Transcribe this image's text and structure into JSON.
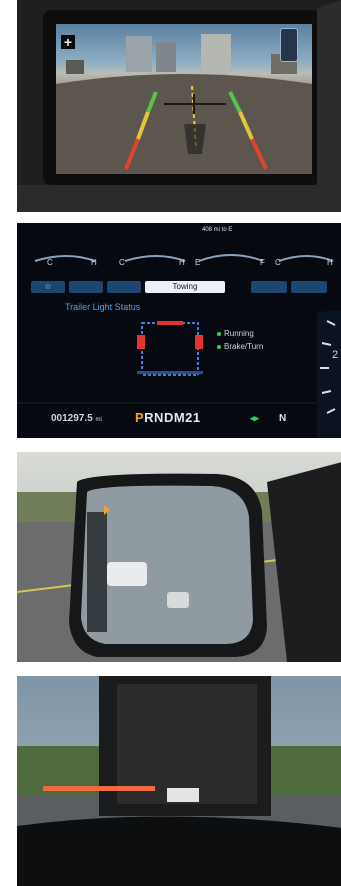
{
  "camera": {
    "plus_label": "+",
    "colors": {
      "near_line": "#e0432c",
      "mid_line": "#e2c63a",
      "far_line": "#58c24b",
      "centerline": "#f1c232"
    }
  },
  "cluster": {
    "top_readout": "408 mi to E",
    "fuel_empty": "E",
    "fuel_full": "F",
    "gauge_cold": "C",
    "gauge_hot": "H",
    "tabs": [
      "☆",
      "Towing"
    ],
    "status_title": "Trailer Light Status",
    "legend": [
      {
        "label": "Running",
        "color": "#2fd35a"
      },
      {
        "label": "Brake/Turn",
        "color": "#2fd35a"
      }
    ],
    "odometer_value": "001297.5",
    "odometer_unit": "mi",
    "gear_selected": "P",
    "gear_rest": "RNDM21",
    "right_indicator": "N",
    "speed_digit": "2",
    "colors": {
      "accent": "#1d4670",
      "gear_selected": "#f3a52b",
      "trailer_frame": "#3d7fe0",
      "trailer_lights": "#e23232"
    }
  },
  "mirror": {
    "colors": {
      "mirror_glass": "#8f9aa1",
      "housing": "#151719",
      "warning": "#f0a324"
    }
  },
  "truck": {
    "colors": {
      "trailer_lights": "#f06a3e",
      "truck_body": "#1b1c1e",
      "sky": "#8fa3b2"
    }
  }
}
